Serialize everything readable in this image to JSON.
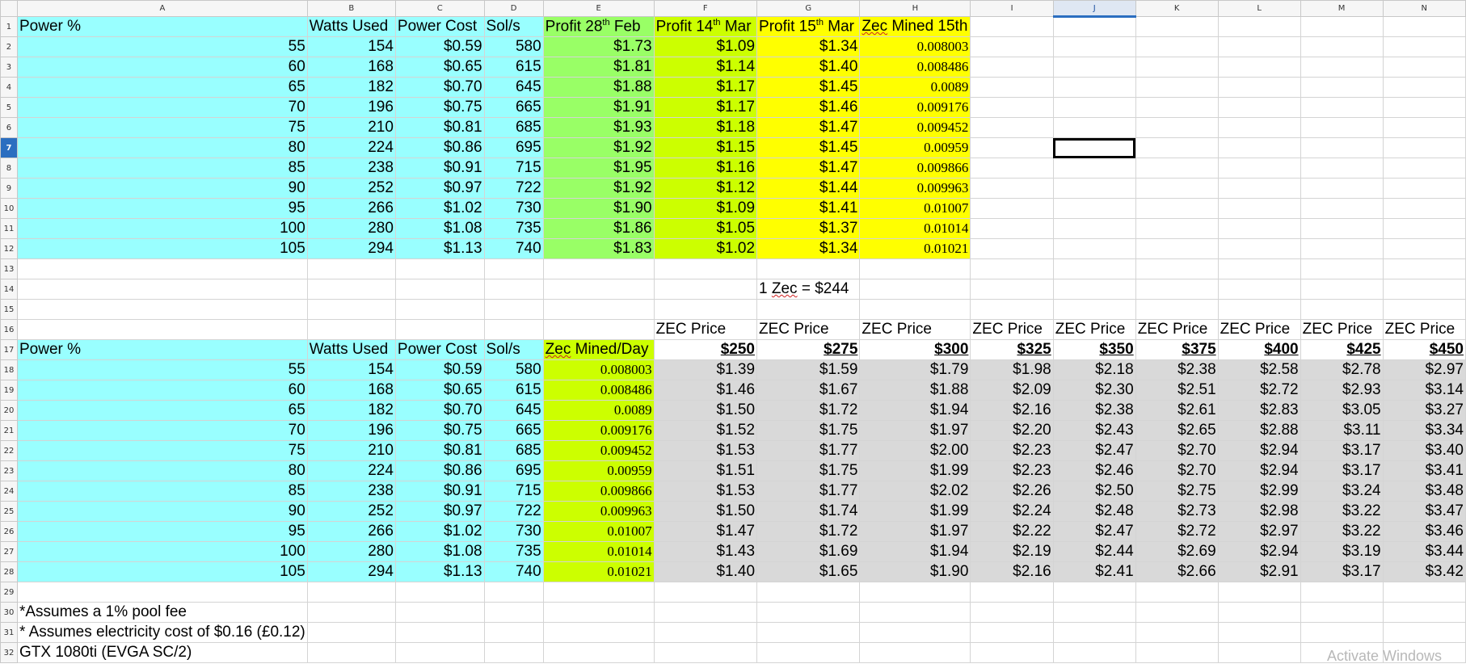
{
  "columns": [
    "A",
    "B",
    "C",
    "D",
    "E",
    "F",
    "G",
    "H",
    "I",
    "J",
    "K",
    "L",
    "M",
    "N"
  ],
  "selected_column": "J",
  "selected_row": 7,
  "top_table": {
    "headers": [
      {
        "text": "Power %"
      },
      {
        "text": "Watts Used"
      },
      {
        "text": "Power Cost"
      },
      {
        "text": "Sol/s"
      },
      {
        "pre": "Profit 28",
        "sup": "th",
        "post": " Feb"
      },
      {
        "pre": "Profit 14",
        "sup": "th",
        "post": " Mar"
      },
      {
        "pre": "Profit 15",
        "sup": "th",
        "post": " Mar"
      },
      {
        "squig": "Zec",
        "post": " Mined 15th"
      }
    ],
    "rows": [
      [
        "55",
        "154",
        "$0.59",
        "580",
        "$1.73",
        "$1.09",
        "$1.34",
        "0.008003"
      ],
      [
        "60",
        "168",
        "$0.65",
        "615",
        "$1.81",
        "$1.14",
        "$1.40",
        "0.008486"
      ],
      [
        "65",
        "182",
        "$0.70",
        "645",
        "$1.88",
        "$1.17",
        "$1.45",
        "0.0089"
      ],
      [
        "70",
        "196",
        "$0.75",
        "665",
        "$1.91",
        "$1.17",
        "$1.46",
        "0.009176"
      ],
      [
        "75",
        "210",
        "$0.81",
        "685",
        "$1.93",
        "$1.18",
        "$1.47",
        "0.009452"
      ],
      [
        "80",
        "224",
        "$0.86",
        "695",
        "$1.92",
        "$1.15",
        "$1.45",
        "0.00959"
      ],
      [
        "85",
        "238",
        "$0.91",
        "715",
        "$1.95",
        "$1.16",
        "$1.47",
        "0.009866"
      ],
      [
        "90",
        "252",
        "$0.97",
        "722",
        "$1.92",
        "$1.12",
        "$1.44",
        "0.009963"
      ],
      [
        "95",
        "266",
        "$1.02",
        "730",
        "$1.90",
        "$1.09",
        "$1.41",
        "0.01007"
      ],
      [
        "100",
        "280",
        "$1.08",
        "735",
        "$1.86",
        "$1.05",
        "$1.37",
        "0.01014"
      ],
      [
        "105",
        "294",
        "$1.13",
        "740",
        "$1.83",
        "$1.02",
        "$1.34",
        "0.01021"
      ]
    ]
  },
  "zec_rate": {
    "pre": "1 ",
    "squig": "Zec",
    "post": " = $244"
  },
  "zec_price_label": "ZEC Price",
  "zec_prices": [
    "$250",
    "$275",
    "$300",
    "$325",
    "$350",
    "$375",
    "$400",
    "$425",
    "$450"
  ],
  "bottom_table": {
    "headers": [
      {
        "text": "Power %"
      },
      {
        "text": "Watts Used"
      },
      {
        "text": "Power Cost"
      },
      {
        "text": "Sol/s"
      },
      {
        "squig": "Zec",
        "post": " Mined/Day"
      }
    ],
    "rows": [
      [
        "55",
        "154",
        "$0.59",
        "580",
        "0.008003",
        "$1.39",
        "$1.59",
        "$1.79",
        "$1.98",
        "$2.18",
        "$2.38",
        "$2.58",
        "$2.78",
        "$2.97"
      ],
      [
        "60",
        "168",
        "$0.65",
        "615",
        "0.008486",
        "$1.46",
        "$1.67",
        "$1.88",
        "$2.09",
        "$2.30",
        "$2.51",
        "$2.72",
        "$2.93",
        "$3.14"
      ],
      [
        "65",
        "182",
        "$0.70",
        "645",
        "0.0089",
        "$1.50",
        "$1.72",
        "$1.94",
        "$2.16",
        "$2.38",
        "$2.61",
        "$2.83",
        "$3.05",
        "$3.27"
      ],
      [
        "70",
        "196",
        "$0.75",
        "665",
        "0.009176",
        "$1.52",
        "$1.75",
        "$1.97",
        "$2.20",
        "$2.43",
        "$2.65",
        "$2.88",
        "$3.11",
        "$3.34"
      ],
      [
        "75",
        "210",
        "$0.81",
        "685",
        "0.009452",
        "$1.53",
        "$1.77",
        "$2.00",
        "$2.23",
        "$2.47",
        "$2.70",
        "$2.94",
        "$3.17",
        "$3.40"
      ],
      [
        "80",
        "224",
        "$0.86",
        "695",
        "0.00959",
        "$1.51",
        "$1.75",
        "$1.99",
        "$2.23",
        "$2.46",
        "$2.70",
        "$2.94",
        "$3.17",
        "$3.41"
      ],
      [
        "85",
        "238",
        "$0.91",
        "715",
        "0.009866",
        "$1.53",
        "$1.77",
        "$2.02",
        "$2.26",
        "$2.50",
        "$2.75",
        "$2.99",
        "$3.24",
        "$3.48"
      ],
      [
        "90",
        "252",
        "$0.97",
        "722",
        "0.009963",
        "$1.50",
        "$1.74",
        "$1.99",
        "$2.24",
        "$2.48",
        "$2.73",
        "$2.98",
        "$3.22",
        "$3.47"
      ],
      [
        "95",
        "266",
        "$1.02",
        "730",
        "0.01007",
        "$1.47",
        "$1.72",
        "$1.97",
        "$2.22",
        "$2.47",
        "$2.72",
        "$2.97",
        "$3.22",
        "$3.46"
      ],
      [
        "100",
        "280",
        "$1.08",
        "735",
        "0.01014",
        "$1.43",
        "$1.69",
        "$1.94",
        "$2.19",
        "$2.44",
        "$2.69",
        "$2.94",
        "$3.19",
        "$3.44"
      ],
      [
        "105",
        "294",
        "$1.13",
        "740",
        "0.01021",
        "$1.40",
        "$1.65",
        "$1.90",
        "$2.16",
        "$2.41",
        "$2.66",
        "$2.91",
        "$3.17",
        "$3.42"
      ]
    ]
  },
  "notes": [
    "*Assumes a 1% pool fee",
    "* Assumes electricity cost of $0.16 (£0.12)",
    "GTX 1080ti (EVGA SC/2)"
  ],
  "watermark": "Activate Windows",
  "colors": {
    "cyan": "#99ffff",
    "green": "#99ff66",
    "lime": "#ccff00",
    "yellow": "#ffff00",
    "grey": "#d9d9d9",
    "selection": "#2b6ec0"
  }
}
